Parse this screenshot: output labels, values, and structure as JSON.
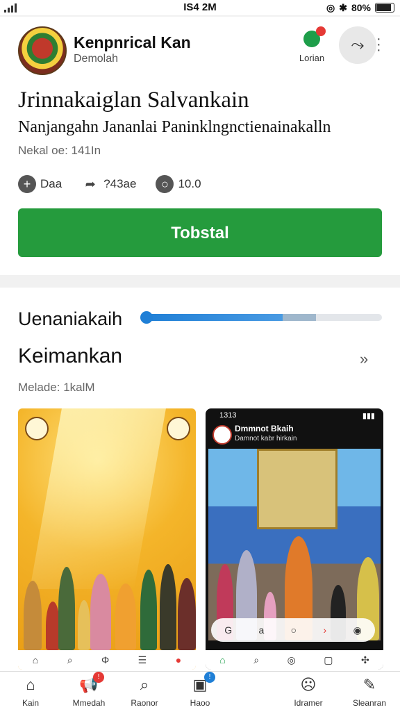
{
  "status_bar": {
    "time": "IS4 2M",
    "battery": "80%"
  },
  "app": {
    "name": "Kenpnrical Kan",
    "subtitle": "Demolah",
    "follow_label": "Lorian",
    "title": "Jrinnakaiglan Salvankain",
    "description": "Nanjangahn Jananlai Paninklngnctienainakalln",
    "meta": "Nekal oe: 141In",
    "actions": [
      {
        "icon": "add-icon",
        "label": "Daa"
      },
      {
        "icon": "share-arrow-icon",
        "label": "?43ae"
      },
      {
        "icon": "comment-icon",
        "label": "10.0"
      }
    ],
    "install_label": "Tobstal"
  },
  "progress": {
    "label": "Uenaniakaih",
    "value": 0.6
  },
  "section": {
    "title": "Keimankan",
    "arrow": "»",
    "meta": "Melade: 1kalM"
  },
  "screenshot2": {
    "status_time": "1313",
    "header_name": "Dmmnot Bkaih",
    "header_sub": "Damnot kabr hirkain"
  },
  "bottom_nav": [
    {
      "icon": "home-icon",
      "label": "Kain"
    },
    {
      "icon": "megaphone-icon",
      "label": "Mmedah",
      "badge": "!"
    },
    {
      "icon": "search-icon",
      "label": "Raonor"
    },
    {
      "icon": "gamepad-icon",
      "label": "Haoo",
      "badge": "!"
    },
    {
      "icon": "face-icon",
      "label": "Idramer"
    },
    {
      "icon": "edit-icon",
      "label": "Sleanran"
    }
  ],
  "colors": {
    "install": "#259b3d",
    "progress": "#1f7fd6"
  }
}
